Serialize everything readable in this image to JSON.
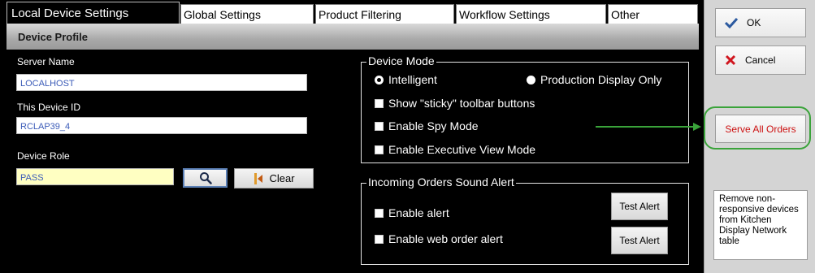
{
  "tabs": [
    {
      "label": "Local Device Settings"
    },
    {
      "label": "Global Settings"
    },
    {
      "label": "Product Filtering"
    },
    {
      "label": "Workflow Settings"
    },
    {
      "label": "Other"
    }
  ],
  "profile": {
    "header": "Device Profile",
    "server_name_label": "Server Name",
    "server_name_value": "LOCALHOST",
    "device_id_label": "This Device ID",
    "device_id_value": "RCLAP39_4",
    "device_role_label": "Device Role",
    "device_role_value": "PASS",
    "clear_label": "Clear"
  },
  "device_mode": {
    "title": "Device Mode",
    "radio_intelligent": "Intelligent",
    "radio_production": "Production Display Only",
    "selected": "Intelligent",
    "options": [
      {
        "label": "Show \"sticky\" toolbar buttons",
        "checked": false
      },
      {
        "label": "Enable Spy Mode",
        "checked": false
      },
      {
        "label": "Enable Executive View Mode",
        "checked": false
      }
    ]
  },
  "sound_alert": {
    "title": "Incoming Orders Sound Alert",
    "options": [
      {
        "label": "Enable alert",
        "checked": false,
        "button": "Test Alert"
      },
      {
        "label": "Enable web order alert",
        "checked": false,
        "button": "Test Alert"
      }
    ]
  },
  "sidebar": {
    "ok_label": "OK",
    "cancel_label": "Cancel",
    "serve_all_label": "Serve All Orders",
    "note": "Remove non-responsive devices from Kitchen Display Network table"
  },
  "colors": {
    "annotation_green": "#3aa33a",
    "serve_all_red": "#cc1111",
    "input_text_blue": "#3b5bb8",
    "role_field_yellow": "#ffffc2"
  }
}
